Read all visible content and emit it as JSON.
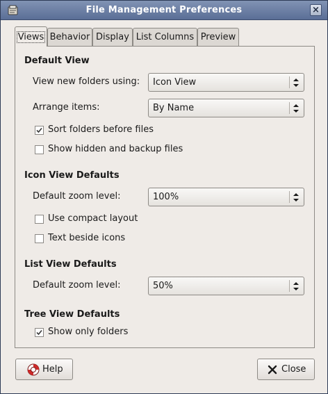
{
  "window": {
    "title": "File Management Preferences"
  },
  "tabs": [
    {
      "label": "Views",
      "active": true
    },
    {
      "label": "Behavior"
    },
    {
      "label": "Display"
    },
    {
      "label": "List Columns"
    },
    {
      "label": "Preview"
    }
  ],
  "default_view": {
    "title": "Default View",
    "view_new_folders_label": "View new folders using:",
    "view_new_folders_value": "Icon View",
    "arrange_items_label": "Arrange items:",
    "arrange_items_value": "By Name",
    "sort_folders": {
      "label": "Sort folders before files",
      "checked": true
    },
    "show_hidden": {
      "label": "Show hidden and backup files",
      "checked": false
    }
  },
  "icon_view_defaults": {
    "title": "Icon View Defaults",
    "zoom_label": "Default zoom level:",
    "zoom_value": "100%",
    "compact_layout": {
      "label": "Use compact layout",
      "checked": false
    },
    "text_beside_icons": {
      "label": "Text beside icons",
      "checked": false
    }
  },
  "list_view_defaults": {
    "title": "List View Defaults",
    "zoom_label": "Default zoom level:",
    "zoom_value": "50%"
  },
  "tree_view_defaults": {
    "title": "Tree View Defaults",
    "show_only_folders": {
      "label": "Show only folders",
      "checked": true
    }
  },
  "buttons": {
    "help": "Help",
    "close": "Close"
  },
  "icons": {
    "app": "preferences-icon",
    "titlebar_close": "close-x-icon",
    "help": "help-lifebuoy-icon",
    "close": "close-x-icon",
    "combo": "updown-arrows-icon",
    "check": "checkmark-icon"
  }
}
